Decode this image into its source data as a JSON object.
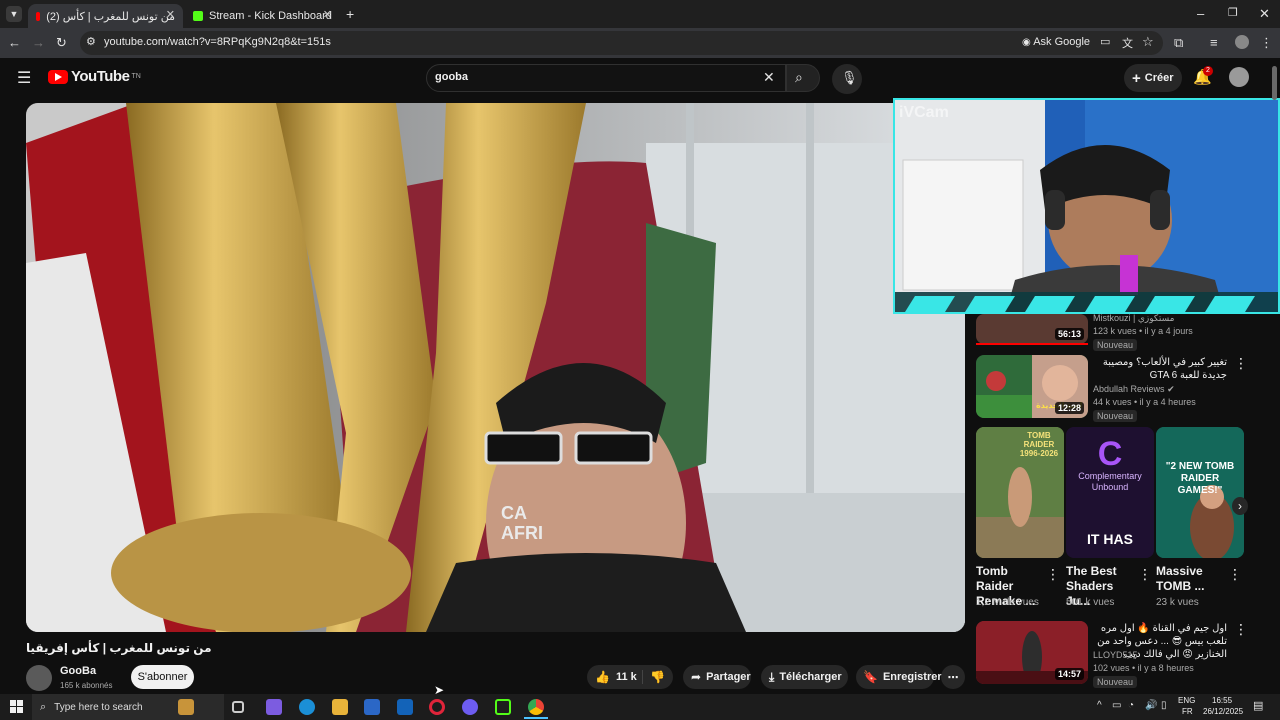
{
  "browser": {
    "tabs": [
      {
        "label": "من تونس للمغرب | كأس (2)",
        "active": true
      },
      {
        "label": "Stream - Kick Dashboard",
        "active": false
      }
    ],
    "url": "youtube.com/watch?v=8RPqKg9N2q8&t=151s",
    "ask_google": "Ask Google"
  },
  "youtube": {
    "logo": "YouTube",
    "logo_sup": "TN",
    "search_value": "gooba",
    "create_label": "Créer",
    "notif_count": "2"
  },
  "webcam": {
    "label": "iVCam"
  },
  "video": {
    "title": "من تونس للمغرب | كأس إفريقيا",
    "channel": "GooBa",
    "subscribers": "165 k abonnés",
    "subscribe_label": "S'abonner",
    "likes": "11 k",
    "share_label": "Partager",
    "download_label": "Télécharger",
    "save_label": "Enregistrer",
    "overlay_text": "CA AFRI"
  },
  "sidebar": {
    "items": [
      {
        "title": "",
        "channel": "Mistkouzi | مستكوزي",
        "meta": "123 k vues • il y a 4 jours",
        "badge": "Nouveau",
        "duration": "56:13"
      },
      {
        "title": "تغيير كبير في الألعاب؟ ومصيبة جديدة للعبة GTA 6",
        "channel": "Abdullah Reviews",
        "meta": "44 k vues • il y a 4 heures",
        "badge": "Nouveau",
        "duration": "12:28",
        "thumb_text": "لعبة الجديدة"
      },
      {
        "title": "اول جيم في القناة 🔥 اول مره تلعب بيس 😎 ... دعس واحد من الخنازير 😡 الي فالك ديب",
        "channel": "LLOYD515",
        "meta": "102 vues • il y a 8 heures",
        "badge": "Nouveau",
        "duration": "14:57"
      }
    ],
    "shorts": [
      {
        "title": "Tomb Raider Remake ...",
        "views": "1,2 M de vues",
        "thumb_text": "TOMB RAIDER 1996-2026"
      },
      {
        "title": "The Best Shaders Ju...",
        "views": "501 k vues",
        "thumb_text": "Complementary Unbound",
        "thumb_text2": "IT HAS"
      },
      {
        "title": "Massive TOMB ...",
        "views": "23 k vues",
        "thumb_text": "\"2 NEW TOMB RAIDER GAMES!\""
      }
    ]
  },
  "taskbar": {
    "search_placeholder": "Type here to search",
    "lang": "ENG",
    "region": "FR",
    "time": "16:55",
    "date": "26/12/2025"
  },
  "colors": {
    "accent": "#ff0000",
    "cyan": "#39e6e6",
    "bg": "#0f0f0f"
  }
}
